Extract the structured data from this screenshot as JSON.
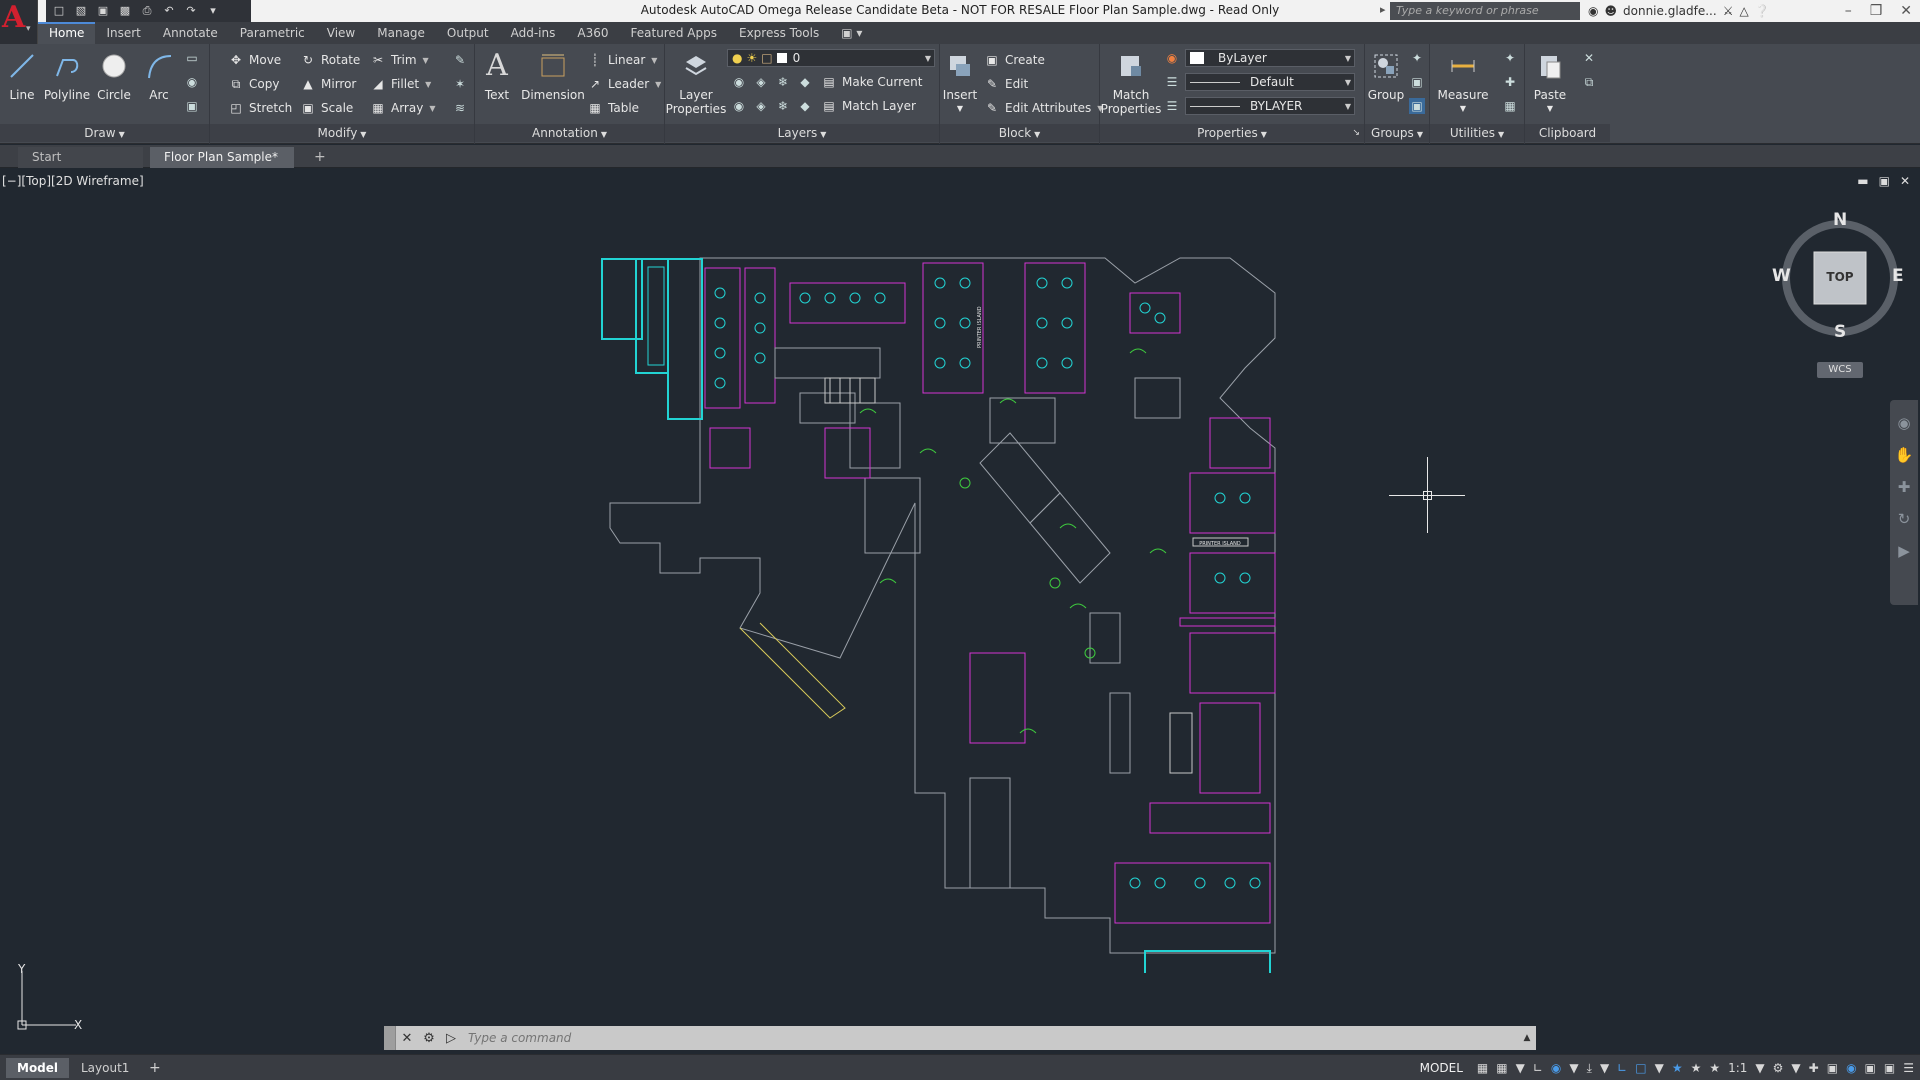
{
  "app": {
    "title": "Autodesk AutoCAD Omega Release Candidate Beta - NOT FOR RESALE    Floor Plan Sample.dwg - Read Only",
    "logo_letter": "A",
    "search_placeholder": "Type a keyword or phrase",
    "user": "donnie.gladfe...",
    "window_controls": [
      "–",
      "❒",
      "✕"
    ]
  },
  "ribbon_tabs": [
    "Home",
    "Insert",
    "Annotate",
    "Parametric",
    "View",
    "Manage",
    "Output",
    "Add-ins",
    "A360",
    "Featured Apps",
    "Express Tools"
  ],
  "active_tab": "Home",
  "panels": {
    "draw": {
      "label": "Draw",
      "line": "Line",
      "polyline": "Polyline",
      "circle": "Circle",
      "arc": "Arc"
    },
    "modify": {
      "label": "Modify",
      "move": "Move",
      "rotate": "Rotate",
      "trim": "Trim",
      "copy": "Copy",
      "mirror": "Mirror",
      "fillet": "Fillet",
      "stretch": "Stretch",
      "scale": "Scale",
      "array": "Array"
    },
    "annotation": {
      "label": "Annotation",
      "text": "Text",
      "dimension": "Dimension",
      "linear": "Linear",
      "leader": "Leader",
      "table": "Table"
    },
    "layers": {
      "label": "Layers",
      "layer_properties_1": "Layer",
      "layer_properties_2": "Properties",
      "current_layer": "0",
      "make_current": "Make Current",
      "match_layer": "Match Layer"
    },
    "block": {
      "label": "Block",
      "insert": "Insert",
      "create": "Create",
      "edit": "Edit",
      "edit_attributes": "Edit Attributes"
    },
    "properties": {
      "label": "Properties",
      "match_1": "Match",
      "match_2": "Properties",
      "color": "ByLayer",
      "linetype": "Default",
      "lineweight": "BYLAYER"
    },
    "groups": {
      "label": "Groups",
      "group": "Group"
    },
    "utilities": {
      "label": "Utilities",
      "measure": "Measure"
    },
    "clipboard": {
      "label": "Clipboard",
      "paste": "Paste"
    }
  },
  "file_tabs": {
    "start": "Start",
    "active": "Floor Plan Sample*"
  },
  "viewport": {
    "label": "[−][Top][2D Wireframe]",
    "viewcube": {
      "n": "N",
      "s": "S",
      "e": "E",
      "w": "W",
      "face": "TOP"
    },
    "wcs": "WCS",
    "ucs_x": "X",
    "ucs_y": "Y",
    "plan_labels": [
      "PRINTER ISLAND",
      "PRINTER ISLAND"
    ]
  },
  "command": {
    "placeholder": "Type a command"
  },
  "status": {
    "model_tab": "Model",
    "layout_tab": "Layout1",
    "add": "+",
    "mode": "MODEL",
    "scale": "1:1"
  },
  "colors": {
    "ribbon_bg": "#464a51",
    "canvas_bg": "#212830",
    "cyan": "#22d3d3",
    "magenta": "#d235d2",
    "green": "#3ecb3e",
    "white": "#e6e6e6",
    "gray": "#9aa0a8",
    "red": "#e23a3a"
  }
}
